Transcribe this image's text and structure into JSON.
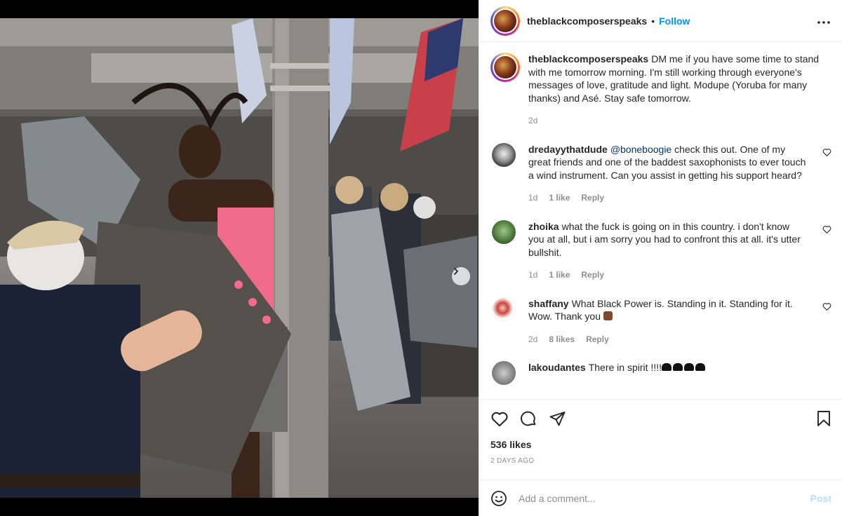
{
  "post": {
    "username": "theblackcomposerspeaks",
    "follow_label": "Follow",
    "separator": "•",
    "more_label": "•••",
    "image_alt": "Protest photo",
    "carousel": {
      "current": 2,
      "total": 2
    }
  },
  "caption": {
    "username": "theblackcomposerspeaks",
    "text": "DM me if you have some time to stand with me tomorrow morning. I'm still working through everyone's messages of love, gratitude and light. Modupe (Yoruba for many thanks) and Asé. Stay safe tomorrow.",
    "age": "2d"
  },
  "comments": [
    {
      "username": "dredayythatdude",
      "mention": "@boneboogie",
      "text": " check this out. One of my great friends and one of the baddest saxophonists to ever touch a wind instrument. Can you assist in getting his support heard?",
      "age": "1d",
      "likes": "1 like",
      "reply_label": "Reply"
    },
    {
      "username": "zhoika",
      "text": "what the fuck is going on in this country. i don't know you at all, but i am sorry you had to confront this at all. it's utter bullshit.",
      "age": "1d",
      "likes": "1 like",
      "reply_label": "Reply"
    },
    {
      "username": "shaffany",
      "text": "What Black Power is. Standing in it. Standing for it. Wow. Thank you",
      "age": "2d",
      "likes": "8 likes",
      "reply_label": "Reply"
    },
    {
      "username": "lakoudantes",
      "text": "There in spirit !!!!"
    }
  ],
  "stats": {
    "likes": "536 likes",
    "date": "2 DAYS AGO"
  },
  "composer": {
    "placeholder": "Add a comment...",
    "post_label": "Post"
  },
  "colors": {
    "link": "#0095f6",
    "post_disabled": "#b2dffc",
    "meta": "#8e8e8e"
  },
  "icons": [
    "emoji-icon",
    "heart-icon",
    "comment-icon",
    "share-icon",
    "bookmark-icon",
    "chevron-right-icon",
    "more-icon"
  ]
}
